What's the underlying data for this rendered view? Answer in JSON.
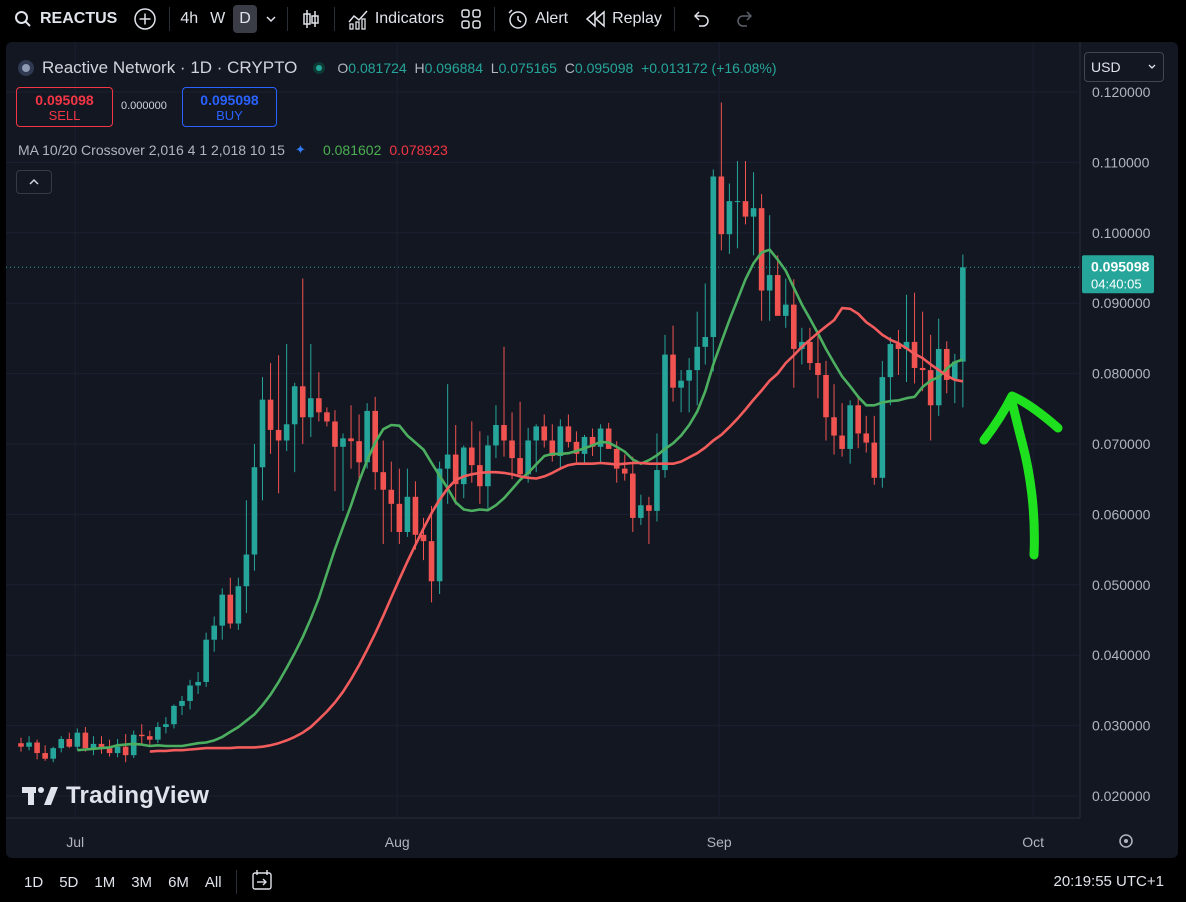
{
  "toolbar": {
    "symbol": "REACTUS",
    "intervals": [
      "4h",
      "W",
      "D"
    ],
    "active_interval": "D",
    "indicators_label": "Indicators",
    "alert_label": "Alert",
    "replay_label": "Replay"
  },
  "legend": {
    "title": "Reactive Network · 1D · CRYPTO",
    "o_label": "O",
    "o": "0.081724",
    "h_label": "H",
    "h": "0.096884",
    "l_label": "L",
    "l": "0.075165",
    "c_label": "C",
    "c": "0.095098",
    "change": "+0.013172 (+16.08%)"
  },
  "trade": {
    "sell_price": "0.095098",
    "sell_label": "SELL",
    "spread": "0.000000",
    "buy_price": "0.095098",
    "buy_label": "BUY"
  },
  "indicator": {
    "label": "MA 10/20 Crossover 2,016 4 1 2,018 10 15",
    "fast_value": "0.081602",
    "slow_value": "0.078923"
  },
  "currency": "USD",
  "price_tag": {
    "price": "0.095098",
    "countdown": "04:40:05"
  },
  "watermark": "TradingView",
  "bottom": {
    "ranges": [
      "1D",
      "5D",
      "1M",
      "3M",
      "6M",
      "All"
    ],
    "clock": "20:19:55 UTC+1"
  },
  "colors": {
    "up": "#26a69a",
    "down": "#f05350",
    "ma_fast": "#4caf60",
    "ma_slow": "#f25c5c",
    "arrow": "#1fe01f",
    "bg": "#131722"
  },
  "chart_data": {
    "type": "candlestick",
    "y_ticks": [
      "0.120000",
      "0.110000",
      "0.100000",
      "0.090000",
      "0.080000",
      "0.070000",
      "0.060000",
      "0.050000",
      "0.040000",
      "0.030000",
      "0.020000"
    ],
    "x_ticks": [
      "Jul",
      "Aug",
      "Sep",
      "Oct"
    ],
    "ylim": [
      0.0175,
      0.1225
    ],
    "last_price": 0.095098,
    "candles": [
      {
        "o": 0.0275,
        "h": 0.0283,
        "l": 0.0263,
        "c": 0.027
      },
      {
        "o": 0.027,
        "h": 0.0285,
        "l": 0.0265,
        "c": 0.0276
      },
      {
        "o": 0.0276,
        "h": 0.028,
        "l": 0.0252,
        "c": 0.0261
      },
      {
        "o": 0.0261,
        "h": 0.0272,
        "l": 0.025,
        "c": 0.0253
      },
      {
        "o": 0.0253,
        "h": 0.027,
        "l": 0.0248,
        "c": 0.0268
      },
      {
        "o": 0.0268,
        "h": 0.0285,
        "l": 0.0262,
        "c": 0.0281
      },
      {
        "o": 0.0281,
        "h": 0.029,
        "l": 0.0268,
        "c": 0.027
      },
      {
        "o": 0.027,
        "h": 0.0296,
        "l": 0.0265,
        "c": 0.029
      },
      {
        "o": 0.029,
        "h": 0.0298,
        "l": 0.0263,
        "c": 0.0268
      },
      {
        "o": 0.0268,
        "h": 0.0285,
        "l": 0.0258,
        "c": 0.0274
      },
      {
        "o": 0.0274,
        "h": 0.0285,
        "l": 0.026,
        "c": 0.0268
      },
      {
        "o": 0.0268,
        "h": 0.028,
        "l": 0.0256,
        "c": 0.0261
      },
      {
        "o": 0.0261,
        "h": 0.0281,
        "l": 0.0255,
        "c": 0.027
      },
      {
        "o": 0.027,
        "h": 0.0288,
        "l": 0.0248,
        "c": 0.0258
      },
      {
        "o": 0.0258,
        "h": 0.0293,
        "l": 0.0254,
        "c": 0.0287
      },
      {
        "o": 0.0287,
        "h": 0.0302,
        "l": 0.0272,
        "c": 0.0285
      },
      {
        "o": 0.0285,
        "h": 0.0293,
        "l": 0.027,
        "c": 0.028
      },
      {
        "o": 0.028,
        "h": 0.0305,
        "l": 0.0275,
        "c": 0.0298
      },
      {
        "o": 0.0298,
        "h": 0.0312,
        "l": 0.0289,
        "c": 0.0302
      },
      {
        "o": 0.0302,
        "h": 0.033,
        "l": 0.0296,
        "c": 0.0328
      },
      {
        "o": 0.0328,
        "h": 0.0342,
        "l": 0.0315,
        "c": 0.0335
      },
      {
        "o": 0.0335,
        "h": 0.0365,
        "l": 0.0323,
        "c": 0.0357
      },
      {
        "o": 0.0357,
        "h": 0.0376,
        "l": 0.0345,
        "c": 0.0362
      },
      {
        "o": 0.0362,
        "h": 0.0432,
        "l": 0.0355,
        "c": 0.0422
      },
      {
        "o": 0.0422,
        "h": 0.0455,
        "l": 0.0405,
        "c": 0.0442
      },
      {
        "o": 0.0442,
        "h": 0.0495,
        "l": 0.0422,
        "c": 0.0486
      },
      {
        "o": 0.0486,
        "h": 0.051,
        "l": 0.0438,
        "c": 0.0445
      },
      {
        "o": 0.0445,
        "h": 0.051,
        "l": 0.0436,
        "c": 0.0498
      },
      {
        "o": 0.0498,
        "h": 0.062,
        "l": 0.046,
        "c": 0.0543
      },
      {
        "o": 0.0543,
        "h": 0.07,
        "l": 0.052,
        "c": 0.0667
      },
      {
        "o": 0.0667,
        "h": 0.0795,
        "l": 0.062,
        "c": 0.0763
      },
      {
        "o": 0.0763,
        "h": 0.0815,
        "l": 0.0686,
        "c": 0.072
      },
      {
        "o": 0.072,
        "h": 0.0826,
        "l": 0.063,
        "c": 0.0705
      },
      {
        "o": 0.0705,
        "h": 0.0842,
        "l": 0.069,
        "c": 0.0728
      },
      {
        "o": 0.0728,
        "h": 0.0787,
        "l": 0.066,
        "c": 0.0782
      },
      {
        "o": 0.0782,
        "h": 0.0935,
        "l": 0.07,
        "c": 0.0738
      },
      {
        "o": 0.0738,
        "h": 0.0842,
        "l": 0.071,
        "c": 0.0765
      },
      {
        "o": 0.0765,
        "h": 0.0802,
        "l": 0.0732,
        "c": 0.0745
      },
      {
        "o": 0.0745,
        "h": 0.0752,
        "l": 0.0725,
        "c": 0.0732
      },
      {
        "o": 0.0732,
        "h": 0.0748,
        "l": 0.0633,
        "c": 0.0696
      },
      {
        "o": 0.0696,
        "h": 0.0715,
        "l": 0.0605,
        "c": 0.0708
      },
      {
        "o": 0.0708,
        "h": 0.0755,
        "l": 0.0665,
        "c": 0.0704
      },
      {
        "o": 0.0704,
        "h": 0.0742,
        "l": 0.0651,
        "c": 0.0674
      },
      {
        "o": 0.0674,
        "h": 0.0758,
        "l": 0.0665,
        "c": 0.0747
      },
      {
        "o": 0.0747,
        "h": 0.0767,
        "l": 0.0635,
        "c": 0.066
      },
      {
        "o": 0.066,
        "h": 0.0705,
        "l": 0.0558,
        "c": 0.0635
      },
      {
        "o": 0.0635,
        "h": 0.0675,
        "l": 0.0575,
        "c": 0.0615
      },
      {
        "o": 0.0615,
        "h": 0.0665,
        "l": 0.0558,
        "c": 0.0575
      },
      {
        "o": 0.0575,
        "h": 0.0665,
        "l": 0.0568,
        "c": 0.0625
      },
      {
        "o": 0.0625,
        "h": 0.0647,
        "l": 0.055,
        "c": 0.0571
      },
      {
        "o": 0.0571,
        "h": 0.0595,
        "l": 0.0535,
        "c": 0.0562
      },
      {
        "o": 0.0562,
        "h": 0.0612,
        "l": 0.0475,
        "c": 0.0505
      },
      {
        "o": 0.0505,
        "h": 0.0675,
        "l": 0.0487,
        "c": 0.0665
      },
      {
        "o": 0.0665,
        "h": 0.0785,
        "l": 0.0615,
        "c": 0.0685
      },
      {
        "o": 0.0685,
        "h": 0.0727,
        "l": 0.0614,
        "c": 0.0643
      },
      {
        "o": 0.0643,
        "h": 0.0698,
        "l": 0.0623,
        "c": 0.0695
      },
      {
        "o": 0.0695,
        "h": 0.0732,
        "l": 0.0645,
        "c": 0.067
      },
      {
        "o": 0.067,
        "h": 0.0718,
        "l": 0.0615,
        "c": 0.064
      },
      {
        "o": 0.064,
        "h": 0.0712,
        "l": 0.0608,
        "c": 0.0698
      },
      {
        "o": 0.0698,
        "h": 0.0755,
        "l": 0.068,
        "c": 0.0727
      },
      {
        "o": 0.0727,
        "h": 0.0838,
        "l": 0.0682,
        "c": 0.0705
      },
      {
        "o": 0.0705,
        "h": 0.0745,
        "l": 0.065,
        "c": 0.068
      },
      {
        "o": 0.068,
        "h": 0.076,
        "l": 0.0653,
        "c": 0.0657
      },
      {
        "o": 0.0657,
        "h": 0.0723,
        "l": 0.0645,
        "c": 0.0705
      },
      {
        "o": 0.0705,
        "h": 0.0728,
        "l": 0.066,
        "c": 0.0725
      },
      {
        "o": 0.0725,
        "h": 0.0742,
        "l": 0.0695,
        "c": 0.0705
      },
      {
        "o": 0.0705,
        "h": 0.0728,
        "l": 0.0675,
        "c": 0.0683
      },
      {
        "o": 0.0683,
        "h": 0.0735,
        "l": 0.0665,
        "c": 0.0725
      },
      {
        "o": 0.0725,
        "h": 0.0742,
        "l": 0.0695,
        "c": 0.0703
      },
      {
        "o": 0.0703,
        "h": 0.0718,
        "l": 0.0674,
        "c": 0.0686
      },
      {
        "o": 0.0686,
        "h": 0.0713,
        "l": 0.0672,
        "c": 0.071
      },
      {
        "o": 0.071,
        "h": 0.0722,
        "l": 0.0683,
        "c": 0.0696
      },
      {
        "o": 0.0696,
        "h": 0.0728,
        "l": 0.0672,
        "c": 0.0722
      },
      {
        "o": 0.0722,
        "h": 0.073,
        "l": 0.0695,
        "c": 0.0693
      },
      {
        "o": 0.0693,
        "h": 0.0704,
        "l": 0.0645,
        "c": 0.0665
      },
      {
        "o": 0.0665,
        "h": 0.0685,
        "l": 0.0648,
        "c": 0.0658
      },
      {
        "o": 0.0658,
        "h": 0.0682,
        "l": 0.0575,
        "c": 0.0595
      },
      {
        "o": 0.0595,
        "h": 0.0628,
        "l": 0.0585,
        "c": 0.0613
      },
      {
        "o": 0.0613,
        "h": 0.0625,
        "l": 0.0558,
        "c": 0.0605
      },
      {
        "o": 0.0605,
        "h": 0.0715,
        "l": 0.059,
        "c": 0.0663
      },
      {
        "o": 0.0663,
        "h": 0.0855,
        "l": 0.0652,
        "c": 0.0827
      },
      {
        "o": 0.0827,
        "h": 0.0868,
        "l": 0.076,
        "c": 0.078
      },
      {
        "o": 0.078,
        "h": 0.0805,
        "l": 0.0745,
        "c": 0.079
      },
      {
        "o": 0.079,
        "h": 0.0822,
        "l": 0.0745,
        "c": 0.0805
      },
      {
        "o": 0.0805,
        "h": 0.0888,
        "l": 0.0755,
        "c": 0.0838
      },
      {
        "o": 0.0838,
        "h": 0.0928,
        "l": 0.0813,
        "c": 0.0852
      },
      {
        "o": 0.0852,
        "h": 0.109,
        "l": 0.0803,
        "c": 0.108
      },
      {
        "o": 0.108,
        "h": 0.1185,
        "l": 0.0975,
        "c": 0.0998
      },
      {
        "o": 0.0998,
        "h": 0.107,
        "l": 0.097,
        "c": 0.1045
      },
      {
        "o": 0.1045,
        "h": 0.1102,
        "l": 0.0978,
        "c": 0.1045
      },
      {
        "o": 0.1045,
        "h": 0.1102,
        "l": 0.1012,
        "c": 0.1023
      },
      {
        "o": 0.1023,
        "h": 0.1086,
        "l": 0.0968,
        "c": 0.1035
      },
      {
        "o": 0.1035,
        "h": 0.1055,
        "l": 0.0875,
        "c": 0.0918
      },
      {
        "o": 0.0918,
        "h": 0.1025,
        "l": 0.0875,
        "c": 0.094
      },
      {
        "o": 0.094,
        "h": 0.0968,
        "l": 0.0886,
        "c": 0.0882
      },
      {
        "o": 0.0882,
        "h": 0.0935,
        "l": 0.0865,
        "c": 0.0898
      },
      {
        "o": 0.0898,
        "h": 0.0934,
        "l": 0.078,
        "c": 0.0835
      },
      {
        "o": 0.0835,
        "h": 0.0865,
        "l": 0.0813,
        "c": 0.0845
      },
      {
        "o": 0.0845,
        "h": 0.0865,
        "l": 0.0805,
        "c": 0.0815
      },
      {
        "o": 0.0815,
        "h": 0.0854,
        "l": 0.0765,
        "c": 0.0798
      },
      {
        "o": 0.0798,
        "h": 0.0818,
        "l": 0.0705,
        "c": 0.0738
      },
      {
        "o": 0.0738,
        "h": 0.0785,
        "l": 0.0685,
        "c": 0.0712
      },
      {
        "o": 0.0712,
        "h": 0.0758,
        "l": 0.0682,
        "c": 0.0693
      },
      {
        "o": 0.0693,
        "h": 0.0762,
        "l": 0.0672,
        "c": 0.0755
      },
      {
        "o": 0.0755,
        "h": 0.0768,
        "l": 0.0694,
        "c": 0.0715
      },
      {
        "o": 0.0715,
        "h": 0.074,
        "l": 0.0688,
        "c": 0.0702
      },
      {
        "o": 0.0702,
        "h": 0.074,
        "l": 0.0642,
        "c": 0.0652
      },
      {
        "o": 0.0652,
        "h": 0.0818,
        "l": 0.0638,
        "c": 0.0795
      },
      {
        "o": 0.0795,
        "h": 0.0852,
        "l": 0.0755,
        "c": 0.0842
      },
      {
        "o": 0.0842,
        "h": 0.0862,
        "l": 0.0798,
        "c": 0.0835
      },
      {
        "o": 0.0835,
        "h": 0.0912,
        "l": 0.0788,
        "c": 0.0845
      },
      {
        "o": 0.0845,
        "h": 0.0915,
        "l": 0.0786,
        "c": 0.0808
      },
      {
        "o": 0.0808,
        "h": 0.0888,
        "l": 0.0775,
        "c": 0.0805
      },
      {
        "o": 0.0805,
        "h": 0.0855,
        "l": 0.0705,
        "c": 0.0755
      },
      {
        "o": 0.0755,
        "h": 0.0878,
        "l": 0.074,
        "c": 0.0835
      },
      {
        "o": 0.0835,
        "h": 0.0846,
        "l": 0.0772,
        "c": 0.0791
      },
      {
        "o": 0.0791,
        "h": 0.0828,
        "l": 0.0758,
        "c": 0.0817
      },
      {
        "o": 0.0817,
        "h": 0.0969,
        "l": 0.0752,
        "c": 0.0951
      }
    ],
    "series": [
      {
        "name": "MA fast",
        "value": 0.081602,
        "values": [
          0.0265,
          0.0266,
          0.0267,
          0.0268,
          0.0269,
          0.0272,
          0.0273,
          0.0274,
          0.0273,
          0.0271,
          0.0272,
          0.0271,
          0.0271,
          0.0271,
          0.0273,
          0.0275,
          0.0276,
          0.0279,
          0.0284,
          0.0291,
          0.0298,
          0.0307,
          0.0316,
          0.0329,
          0.0344,
          0.0362,
          0.0382,
          0.0403,
          0.0426,
          0.0452,
          0.0481,
          0.0516,
          0.0551,
          0.0582,
          0.0613,
          0.0647,
          0.0677,
          0.0702,
          0.0721,
          0.0727,
          0.0726,
          0.0712,
          0.0702,
          0.0692,
          0.0673,
          0.0655,
          0.0637,
          0.0617,
          0.0607,
          0.0605,
          0.0607,
          0.0606,
          0.0613,
          0.0623,
          0.0636,
          0.0649,
          0.0659,
          0.0671,
          0.0683,
          0.0686,
          0.0686,
          0.0687,
          0.069,
          0.0694,
          0.0698,
          0.0703,
          0.0702,
          0.0696,
          0.0689,
          0.0678,
          0.0672,
          0.0677,
          0.0684,
          0.0693,
          0.0701,
          0.0712,
          0.0727,
          0.0746,
          0.0775,
          0.0813,
          0.0845,
          0.0876,
          0.0905,
          0.0934,
          0.0957,
          0.0972,
          0.0976,
          0.0962,
          0.0946,
          0.0922,
          0.0898,
          0.0878,
          0.0857,
          0.0835,
          0.0815,
          0.0796,
          0.0782,
          0.0767,
          0.0755,
          0.0755,
          0.0759,
          0.0761,
          0.0762,
          0.0765,
          0.0767,
          0.0781,
          0.079,
          0.0795,
          0.0807,
          0.0816,
          0.082
        ]
      },
      {
        "name": "MA slow",
        "value": 0.078923,
        "values": [
          0.0263,
          0.0264,
          0.0264,
          0.0265,
          0.0265,
          0.0266,
          0.0267,
          0.0268,
          0.0268,
          0.0268,
          0.0268,
          0.0269,
          0.0269,
          0.0269,
          0.027,
          0.0272,
          0.0275,
          0.0279,
          0.0284,
          0.029,
          0.0298,
          0.0309,
          0.032,
          0.0333,
          0.0348,
          0.0366,
          0.0386,
          0.0408,
          0.0431,
          0.0456,
          0.0482,
          0.0508,
          0.0533,
          0.0557,
          0.058,
          0.0602,
          0.0621,
          0.0637,
          0.0649,
          0.0654,
          0.0657,
          0.0659,
          0.066,
          0.066,
          0.0659,
          0.0657,
          0.0654,
          0.0652,
          0.0651,
          0.0654,
          0.0659,
          0.0665,
          0.067,
          0.0672,
          0.0672,
          0.0672,
          0.0673,
          0.0672,
          0.0671,
          0.0672,
          0.0673,
          0.0673,
          0.0672,
          0.0672,
          0.0672,
          0.0672,
          0.0675,
          0.0681,
          0.0687,
          0.0695,
          0.0705,
          0.0713,
          0.0724,
          0.0736,
          0.0749,
          0.0763,
          0.0776,
          0.079,
          0.08,
          0.0815,
          0.0826,
          0.0838,
          0.0848,
          0.0858,
          0.0867,
          0.0876,
          0.0893,
          0.0892,
          0.0885,
          0.0873,
          0.0865,
          0.0855,
          0.0848,
          0.0843,
          0.0836,
          0.0828,
          0.0822,
          0.0813,
          0.0805,
          0.0797,
          0.0791,
          0.0789
        ]
      }
    ]
  }
}
